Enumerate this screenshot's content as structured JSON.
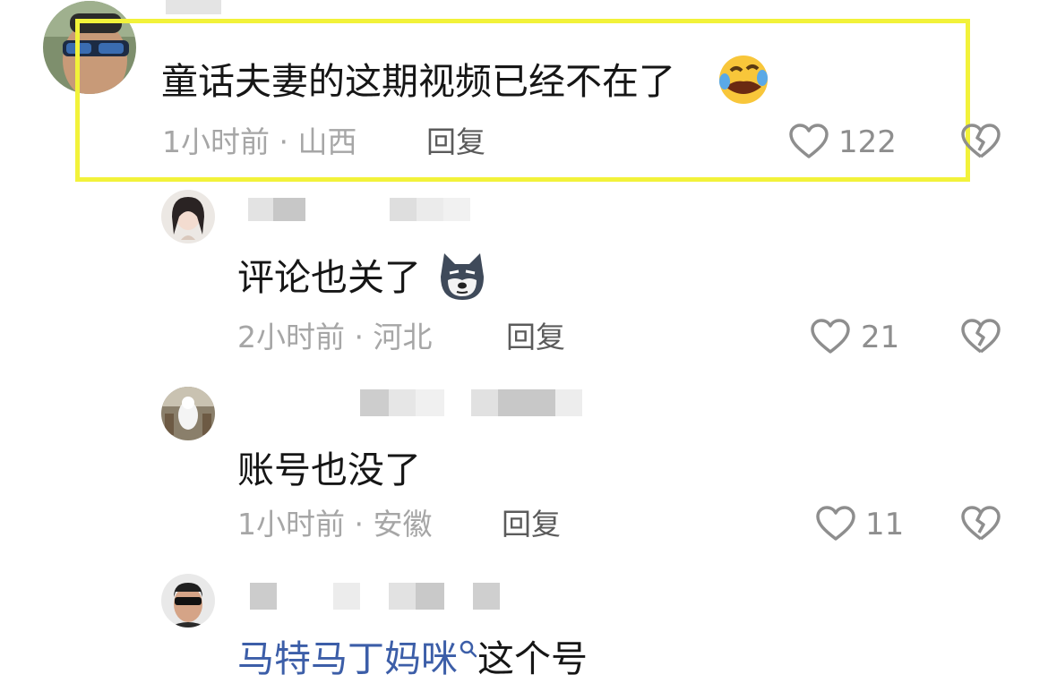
{
  "comments": [
    {
      "text": "童话夫妻的这期视频已经不在了",
      "emoji": "rolling-laughing-emoji",
      "time": "1小时前",
      "sep": " · ",
      "location": "山西",
      "reply_label": "回复",
      "likes": "122",
      "highlighted": true
    },
    {
      "text": "评论也关了",
      "emoji": "husky-dog-emoji",
      "time": "2小时前",
      "sep": " · ",
      "location": "河北",
      "reply_label": "回复",
      "likes": "21"
    },
    {
      "text": "账号也没了",
      "time": "1小时前",
      "sep": " · ",
      "location": "安徽",
      "reply_label": "回复",
      "likes": "11"
    },
    {
      "mention": "马特马丁妈咪",
      "text_after": "这个号"
    }
  ],
  "colors": {
    "highlight": "#f2f23a",
    "meta_text": "#a6a6a6",
    "mention_blue": "#3c5ea8"
  }
}
